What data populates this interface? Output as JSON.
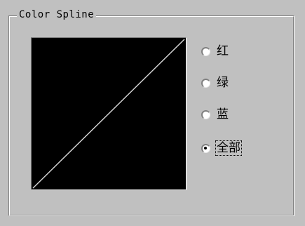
{
  "group": {
    "title": "Color Spline"
  },
  "spline": {
    "background_color": "#000000",
    "curve_color": "#d8d8d8",
    "curve_points": [
      [
        0,
        0
      ],
      [
        1,
        1
      ]
    ]
  },
  "channels": {
    "selected": "all",
    "options": [
      {
        "id": "red",
        "label": "红",
        "checked": false
      },
      {
        "id": "green",
        "label": "绿",
        "checked": false
      },
      {
        "id": "blue",
        "label": "蓝",
        "checked": false
      },
      {
        "id": "all",
        "label": "全部",
        "checked": true
      }
    ]
  }
}
